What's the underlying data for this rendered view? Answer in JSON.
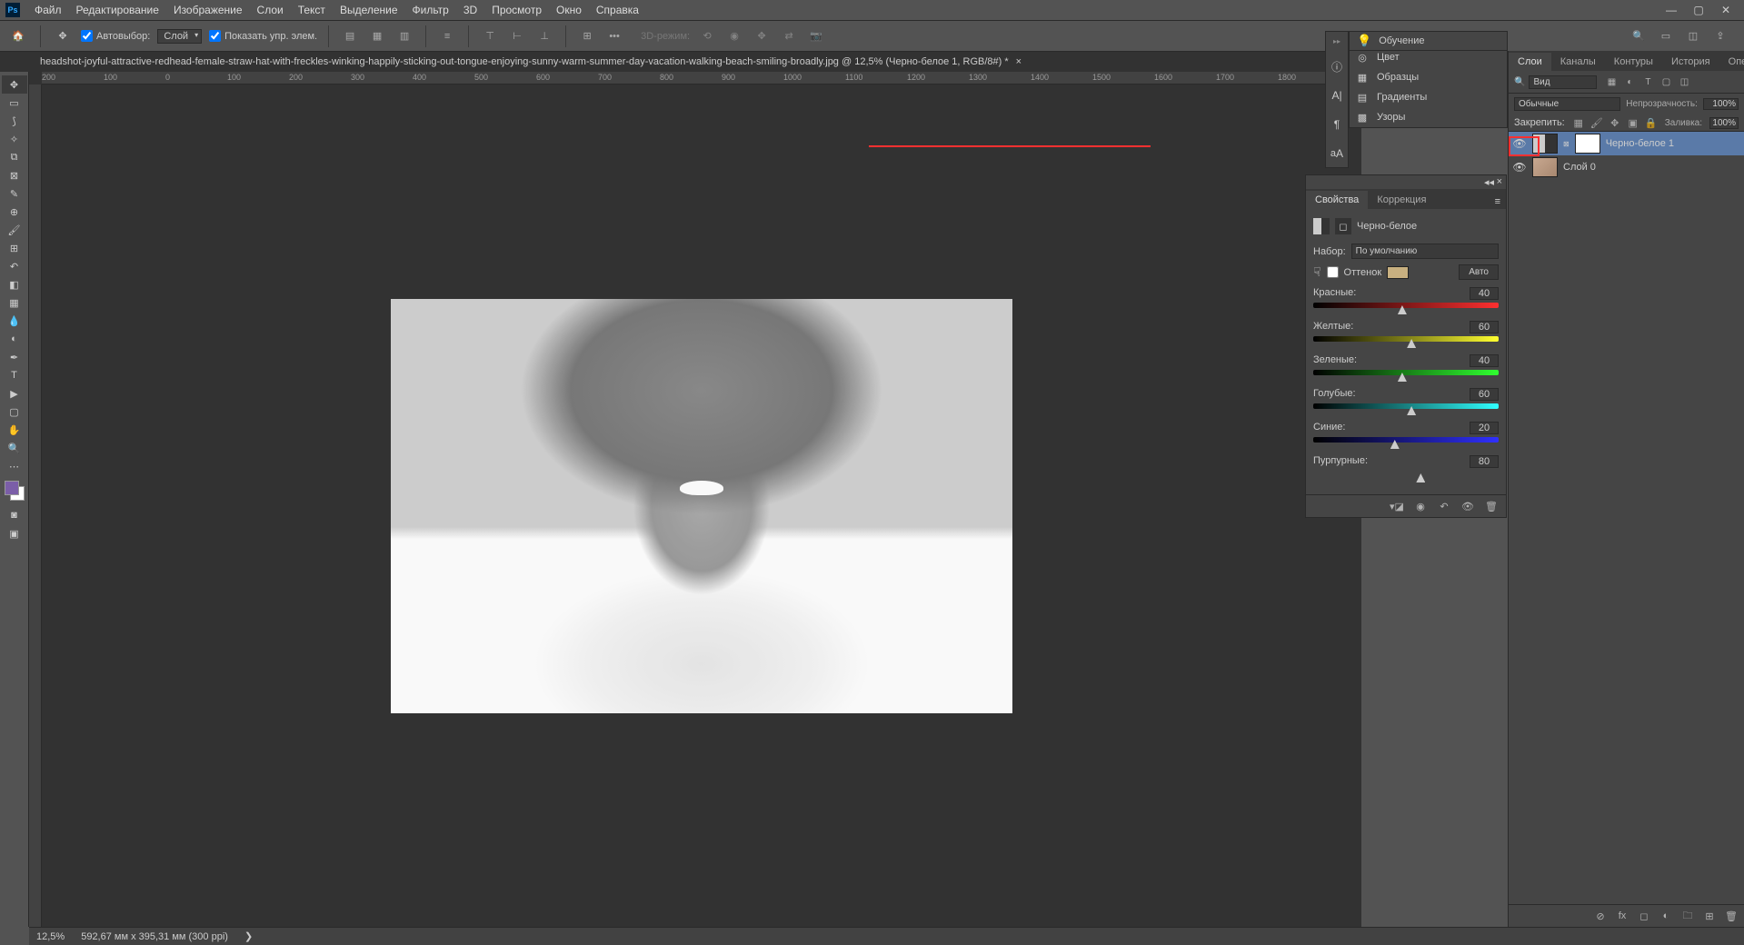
{
  "menubar": [
    "Файл",
    "Редактирование",
    "Изображение",
    "Слои",
    "Текст",
    "Выделение",
    "Фильтр",
    "3D",
    "Просмотр",
    "Окно",
    "Справка"
  ],
  "options": {
    "autoselect": "Автовыбор:",
    "target": "Слой",
    "show_transform": "Показать упр. элем.",
    "mode3d_label": "3D-режим:"
  },
  "doc_tab": "headshot-joyful-attractive-redhead-female-straw-hat-with-freckles-winking-happily-sticking-out-tongue-enjoying-sunny-warm-summer-day-vacation-walking-beach-smiling-broadly.jpg @ 12,5% (Черно-белое 1, RGB/8#) *",
  "ruler_ticks": [
    "200",
    "100",
    "0",
    "100",
    "200",
    "300",
    "400",
    "500",
    "600",
    "700",
    "800",
    "900",
    "1000",
    "1100",
    "1200",
    "1300",
    "1400",
    "1500",
    "1600",
    "1700",
    "1800"
  ],
  "strip_items": [
    {
      "icon": "◎",
      "label": "Цвет"
    },
    {
      "icon": "▦",
      "label": "Образцы"
    },
    {
      "icon": "▤",
      "label": "Градиенты"
    },
    {
      "icon": "▩",
      "label": "Узоры"
    }
  ],
  "learn_label": "Обучение",
  "properties": {
    "tab_props": "Свойства",
    "tab_corr": "Коррекция",
    "adj_name": "Черно-белое",
    "preset_label": "Набор:",
    "preset_value": "По умолчанию",
    "tint_label": "Оттенок",
    "auto": "Авто",
    "sliders": [
      {
        "name": "Красные:",
        "val": "40",
        "cls": "grad-red",
        "pos": 48
      },
      {
        "name": "Желтые:",
        "val": "60",
        "cls": "grad-yel",
        "pos": 53
      },
      {
        "name": "Зеленые:",
        "val": "40",
        "cls": "grad-grn",
        "pos": 48
      },
      {
        "name": "Голубые:",
        "val": "60",
        "cls": "grad-cya",
        "pos": 53
      },
      {
        "name": "Синие:",
        "val": "20",
        "cls": "grad-blu",
        "pos": 44
      },
      {
        "name": "Пурпурные:",
        "val": "80",
        "cls": "",
        "pos": 58
      }
    ]
  },
  "layers": {
    "tabs": [
      "Слои",
      "Каналы",
      "Контуры",
      "История",
      "Операции"
    ],
    "filter_label": "Вид",
    "blend": "Обычные",
    "opacity_label": "Непрозрачность:",
    "opacity": "100%",
    "lock_label": "Закрепить:",
    "fill_label": "Заливка:",
    "fill": "100%",
    "items": [
      {
        "name": "Черно-белое 1",
        "sel": true,
        "type": "adj"
      },
      {
        "name": "Слой 0",
        "sel": false,
        "type": "img"
      }
    ]
  },
  "status": {
    "zoom": "12,5%",
    "dims": "592,67 мм x 395,31 мм (300 ppi)"
  }
}
